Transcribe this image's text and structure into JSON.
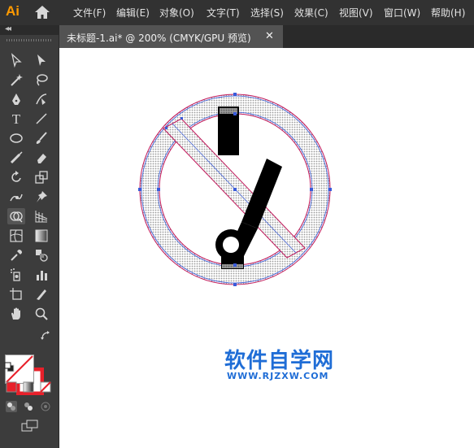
{
  "app": {
    "logo": "Ai"
  },
  "menu": [
    "文件(F)",
    "编辑(E)",
    "对象(O)",
    "文字(T)",
    "选择(S)",
    "效果(C)",
    "视图(V)",
    "窗口(W)",
    "帮助(H)"
  ],
  "toolbar": {
    "collapse_label": "◂◂",
    "text_tool_glyph": "T"
  },
  "document_tab": {
    "title": "未标题-1.ai* @ 200% (CMYK/GPU 预览)",
    "close_glyph": "✕"
  },
  "watermark": {
    "title": "软件自学网",
    "url": "WWW.RJZXW.COM"
  },
  "colors": {
    "menubar_bg": "#323232",
    "panel_bg": "#3c3c3c",
    "logo": "#ff9a00",
    "stroke_red": "#e8202a",
    "watermark_blue": "#1f6dd6",
    "selection_blue": "#3a5bd9"
  }
}
